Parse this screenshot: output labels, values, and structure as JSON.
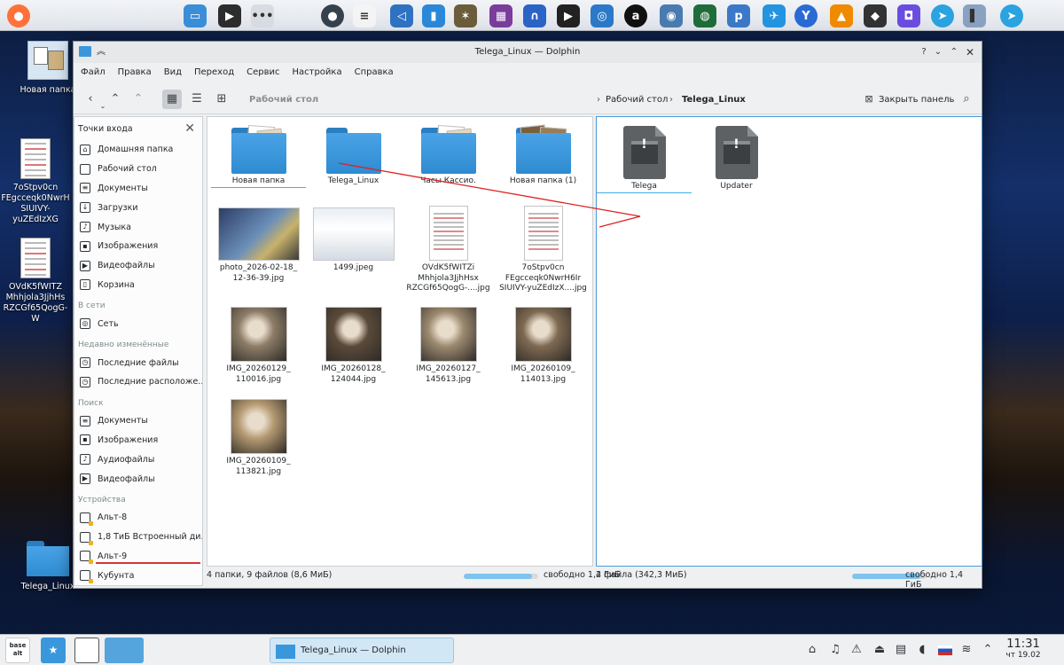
{
  "dock": {
    "icons": [
      "firefox-icon",
      "window-icon",
      "terminal-icon",
      "more-icon",
      "circle-icon",
      "text-editor-icon",
      "vscode-icon",
      "document-icon",
      "gimp-icon",
      "video-editor-icon",
      "headphones-icon",
      "media-icon",
      "vpn-icon",
      "a-icon",
      "webcam-icon",
      "globe-icon",
      "p-icon",
      "browser-icon",
      "yandex-icon",
      "vlc-icon",
      "diamond-icon",
      "messenger-icon",
      "telegram-icon",
      "chart-icon",
      "telegram-icon"
    ]
  },
  "desktop": {
    "items": [
      {
        "label": "Новая папка"
      },
      {
        "label": "7oStpv0cn\nFEgcceqk0NwrH\nSIUIVY-yuZEdIzXG"
      },
      {
        "label": "OVdK5fWITZ\nMhhjola3JjhHs\nRZCGf65QogG-W"
      },
      {
        "label": "Telega_Linux"
      }
    ]
  },
  "window": {
    "title": "Telega_Linux — Dolphin",
    "menu": [
      "Файл",
      "Правка",
      "Вид",
      "Переход",
      "Сервис",
      "Настройка",
      "Справка"
    ],
    "toolbar": {
      "location": "Рабочий стол",
      "breadcrumb": [
        "Рабочий стол",
        "Telega_Linux"
      ],
      "close_panel": "Закрыть панель"
    },
    "places": {
      "header": "Точки входа",
      "sections": [
        {
          "title": "",
          "items": [
            {
              "label": "Домашняя папка",
              "icon": "home-icon"
            },
            {
              "label": "Рабочий стол",
              "icon": "desktop-icon"
            },
            {
              "label": "Документы",
              "icon": "documents-icon"
            },
            {
              "label": "Загрузки",
              "icon": "downloads-icon"
            },
            {
              "label": "Музыка",
              "icon": "music-icon"
            },
            {
              "label": "Изображения",
              "icon": "images-icon"
            },
            {
              "label": "Видеофайлы",
              "icon": "videos-icon"
            },
            {
              "label": "Корзина",
              "icon": "trash-icon"
            }
          ]
        },
        {
          "title": "В сети",
          "items": [
            {
              "label": "Сеть",
              "icon": "network-icon"
            }
          ]
        },
        {
          "title": "Недавно изменённые",
          "items": [
            {
              "label": "Последние файлы",
              "icon": "recent-files-icon"
            },
            {
              "label": "Последние расположе...",
              "icon": "recent-locations-icon"
            }
          ]
        },
        {
          "title": "Поиск",
          "items": [
            {
              "label": "Документы",
              "icon": "search-documents-icon"
            },
            {
              "label": "Изображения",
              "icon": "search-images-icon"
            },
            {
              "label": "Аудиофайлы",
              "icon": "search-audio-icon"
            },
            {
              "label": "Видеофайлы",
              "icon": "search-videos-icon"
            }
          ]
        },
        {
          "title": "Устройства",
          "items": [
            {
              "label": "Альт-8",
              "icon": "drive-icon"
            },
            {
              "label": "1,8 ТиБ Встроенный ди...",
              "icon": "drive-icon"
            },
            {
              "label": "Альт-9",
              "icon": "drive-icon"
            },
            {
              "label": "Кубунта",
              "icon": "drive-icon"
            }
          ]
        }
      ]
    },
    "left_pane": {
      "files": [
        {
          "name": "Новая папка",
          "kind": "folder-docs"
        },
        {
          "name": "Telega_Linux",
          "kind": "folder"
        },
        {
          "name": "Часы Кассио.",
          "kind": "folder-docs"
        },
        {
          "name": "Новая папка (1)",
          "kind": "folder-photos"
        },
        {
          "name": "photo_2026-02-18_\n12-36-39.jpg",
          "kind": "screenshot"
        },
        {
          "name": "1499.jpeg",
          "kind": "screenshot"
        },
        {
          "name": "OVdK5fWITZi\nMhhjola3JjhHsx\nRZCGf65QogG-....jpg",
          "kind": "document"
        },
        {
          "name": "7oStpv0cn\nFEgcceqk0NwrH6Ir\nSIUIVY-yuZEdIzX....jpg",
          "kind": "document"
        },
        {
          "name": "IMG_20260129_\n110016.jpg",
          "kind": "photo"
        },
        {
          "name": "IMG_20260128_\n124044.jpg",
          "kind": "photo"
        },
        {
          "name": "IMG_20260127_\n145613.jpg",
          "kind": "photo"
        },
        {
          "name": "IMG_20260109_\n114013.jpg",
          "kind": "photo"
        },
        {
          "name": "IMG_20260109_\n113821.jpg",
          "kind": "photo"
        }
      ],
      "status": "4 папки, 9 файлов (8,6 МиБ)",
      "free": "свободно 1,4 ГиБ",
      "usage": 0.92
    },
    "right_pane": {
      "files": [
        {
          "name": "Telega",
          "kind": "executable"
        },
        {
          "name": "Updater",
          "kind": "executable"
        }
      ],
      "status": "2 файла (342,3 МиБ)",
      "free": "свободно 1,4 ГиБ",
      "usage": 0.92
    }
  },
  "taskbar": {
    "start_label": "base alt",
    "task_title": "Telega_Linux — Dolphin",
    "clock": {
      "time": "11:31",
      "date": "чт 19.02"
    }
  },
  "colors": {
    "accent": "#3daee9",
    "folder": "#3b97dc",
    "arrow": "#e02020"
  }
}
